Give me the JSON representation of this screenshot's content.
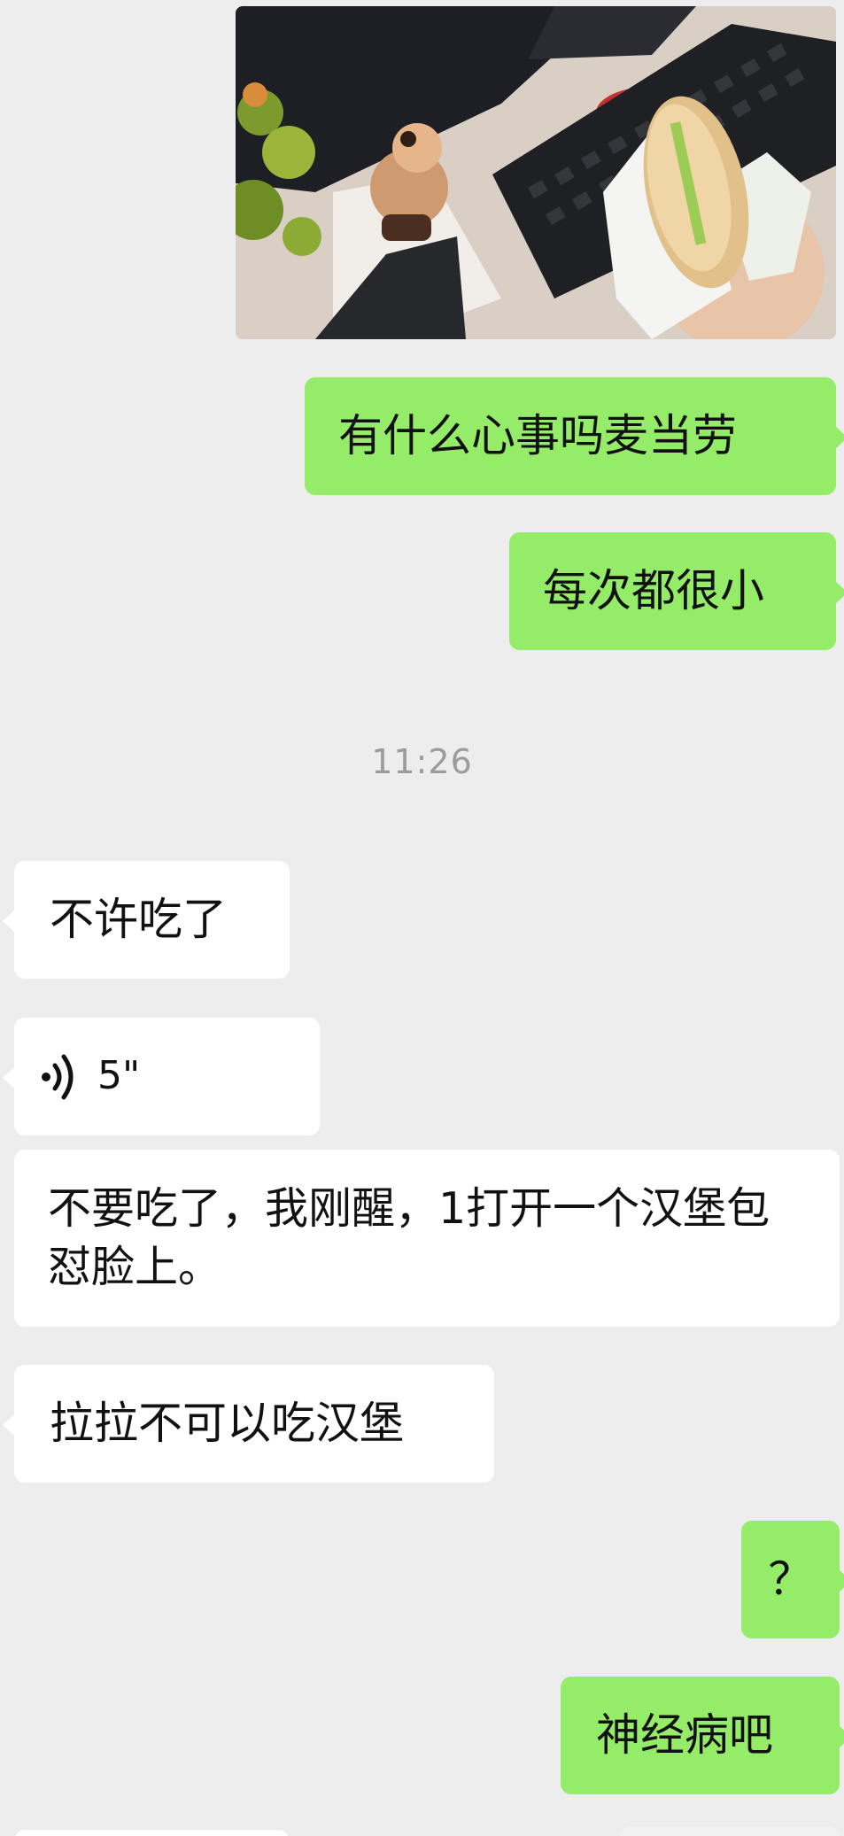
{
  "messages": [
    {
      "kind": "image",
      "side": "sent",
      "description_icon": "photo-burger-desk"
    },
    {
      "kind": "text",
      "side": "sent",
      "text": "有什么心事吗麦当劳"
    },
    {
      "kind": "text",
      "side": "sent",
      "text": "每次都很小"
    },
    {
      "kind": "time",
      "text": "11:26"
    },
    {
      "kind": "text",
      "side": "recv",
      "text": "不许吃了"
    },
    {
      "kind": "voice",
      "side": "recv",
      "duration": "5\"",
      "icon": "voice-wave-icon"
    },
    {
      "kind": "text",
      "side": "recv",
      "text": "不要吃了，我刚醒，1打开一个汉堡包怼脸上。"
    },
    {
      "kind": "text",
      "side": "recv",
      "text": "拉拉不可以吃汉堡"
    },
    {
      "kind": "text",
      "side": "sent",
      "text": "？"
    },
    {
      "kind": "text",
      "side": "sent",
      "text": "神经病吧"
    }
  ],
  "colors": {
    "background": "#ededed",
    "sent_bubble": "#95ec69",
    "recv_bubble": "#ffffff",
    "timestamp": "#9c9c9c"
  }
}
